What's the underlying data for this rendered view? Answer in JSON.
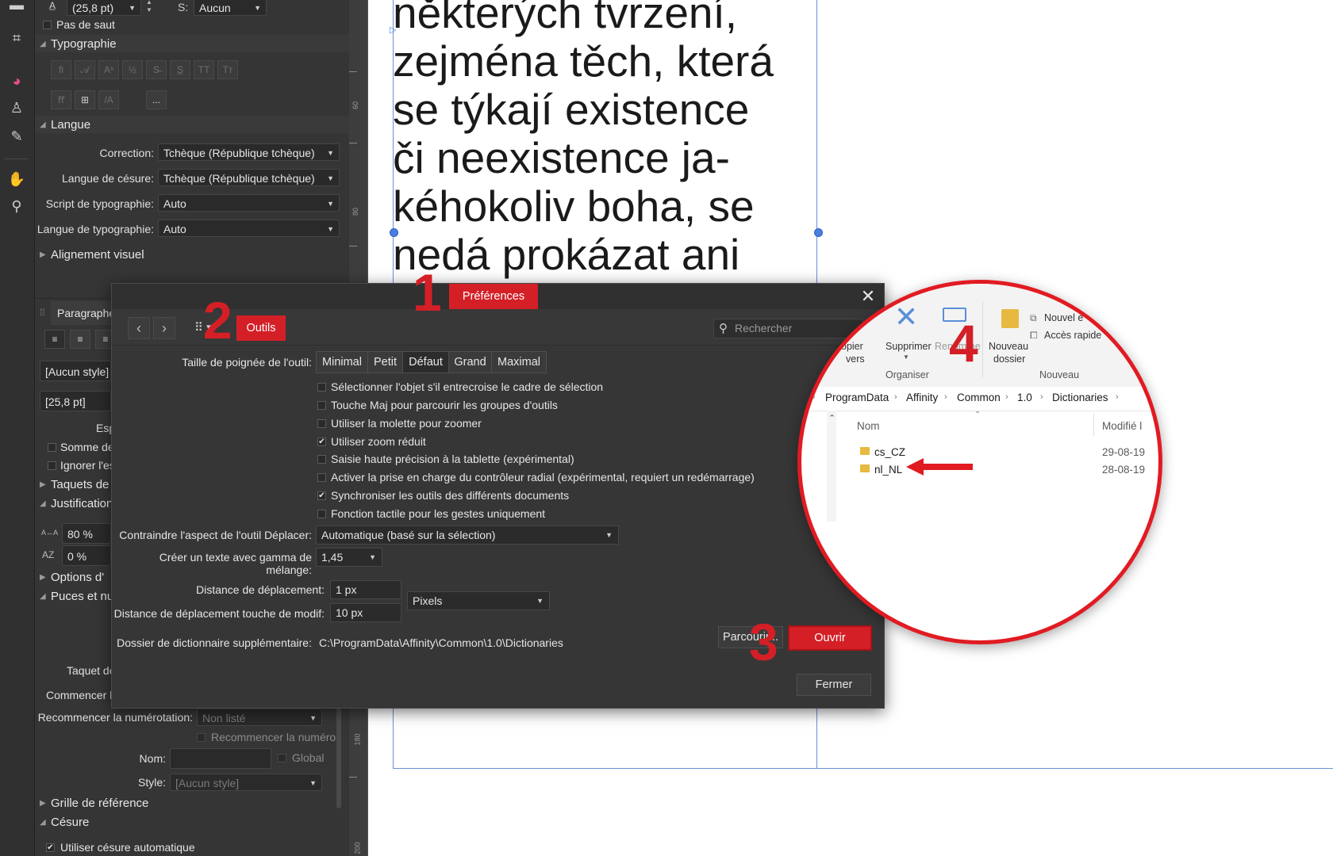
{
  "panel": {
    "font_size_value": "(25,8 pt)",
    "s_label": "S:",
    "s_value": "Aucun",
    "pas_de_saut": "Pas de saut",
    "typographie": "Typographie",
    "more_button": "...",
    "langue": "Langue",
    "correction_label": "Correction:",
    "correction_value": "Tchèque (République tchèque)",
    "cesure_label": "Langue de césure:",
    "cesure_value": "Tchèque (République tchèque)",
    "script_label": "Script de typographie:",
    "script_value": "Auto",
    "langue_typo_label": "Langue de typographie:",
    "langue_typo_value": "Auto",
    "alignement_visuel": "Alignement visuel",
    "paragraphe": "Paragraphe",
    "style_value": "[Aucun style]",
    "size_value": "[25,8 pt]",
    "esp": "Esp",
    "somme": "Somme de",
    "ignorer": "Ignorer l'es",
    "taquets": "Taquets de",
    "justification": "Justification",
    "word_spacing": "80 %",
    "letter_spacing": "0 %",
    "options": "Options d'",
    "puces": "Puces et nu",
    "taquet": "Taquet de",
    "commencer": "Commencer l",
    "recommencer_num_label": "Recommencer la numérotation:",
    "recommencer_num_value": "Non listé",
    "recommencer_check": "Recommencer la numéro",
    "nom_label": "Nom:",
    "global": "Global",
    "style_label": "Style:",
    "style_select": "[Aucun style]",
    "grille": "Grille de référence",
    "cesure": "Césure",
    "utiliser_cesure": "Utiliser césure automatique"
  },
  "ruler": {
    "labels": [
      "60",
      "80",
      "180",
      "200"
    ]
  },
  "document": {
    "lines": [
      "některých tvrzení,",
      "zejména těch, která",
      "se týkají existence",
      "či neexistence ja-",
      "kéhokoliv boha, se",
      "nedá prokázat ani"
    ]
  },
  "dialog": {
    "title": "Préférences",
    "category": "Outils",
    "search_placeholder": "Rechercher",
    "handle_size_label": "Taille de poignée de l'outil:",
    "handle_sizes": [
      "Minimal",
      "Petit",
      "Défaut",
      "Grand",
      "Maximal"
    ],
    "selected_handle_size": "Défaut",
    "options": [
      {
        "label": "Sélectionner l'objet s'il entrecroise le cadre de sélection",
        "checked": false
      },
      {
        "label": "Touche Maj pour parcourir les groupes d'outils",
        "checked": false
      },
      {
        "label": "Utiliser la molette pour zoomer",
        "checked": false
      },
      {
        "label": "Utiliser zoom réduit",
        "checked": true
      },
      {
        "label": "Saisie haute précision à la tablette (expérimental)",
        "checked": false
      },
      {
        "label": "Activer la prise en charge du contrôleur radial (expérimental, requiert un redémarrage)",
        "checked": false
      },
      {
        "label": "Synchroniser les outils des différents documents",
        "checked": true
      },
      {
        "label": "Fonction tactile pour les gestes uniquement",
        "checked": false
      }
    ],
    "contraindre_label": "Contraindre l'aspect de l'outil Déplacer:",
    "contraindre_value": "Automatique (basé sur la sélection)",
    "gamma_label": "Créer un texte avec gamma de mélange:",
    "gamma_value": "1,45",
    "distance_label": "Distance de déplacement:",
    "distance_value": "1 px",
    "unit_value": "Pixels",
    "distance_modif_label": "Distance de déplacement touche de modif:",
    "distance_modif_value": "10 px",
    "dict_label": "Dossier de dictionnaire supplémentaire:",
    "dict_path": "C:\\ProgramData\\Affinity\\Common\\1.0\\Dictionaries",
    "parcourir": "Parcourir...",
    "ouvrir": "Ouvrir",
    "fermer": "Fermer"
  },
  "annotations": {
    "step1": "1",
    "step2": "2",
    "step3": "3",
    "step4": "4"
  },
  "explorer": {
    "copier": "opier",
    "vers": "vers",
    "supprimer": "Supprimer",
    "renommer": "Renomme",
    "nouveau_dossier_1": "Nouveau",
    "nouveau_dossier_2": "dossier",
    "nouvel": "Nouvel é",
    "acces_rapide": "Accès rapide",
    "group_organiser": "Organiser",
    "group_nouveau": "Nouveau",
    "breadcrumb": [
      "ProgramData",
      "Affinity",
      "Common",
      "1.0",
      "Dictionaries"
    ],
    "col_nom": "Nom",
    "col_modifie": "Modifié l",
    "files": [
      {
        "name": "cs_CZ",
        "date": "29-08-19"
      },
      {
        "name": "nl_NL",
        "date": "28-08-19"
      }
    ]
  },
  "colors": {
    "accent": "#d41f26",
    "panel_bg": "#353535",
    "selection": "#4a7fe0"
  }
}
